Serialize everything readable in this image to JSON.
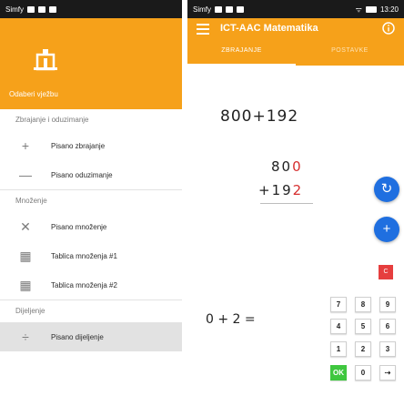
{
  "left_phone": {
    "status": {
      "carrier": "Simfy",
      "right": "ᯤ ⊡"
    },
    "drawer": {
      "header_title": "Odaberi vježbu",
      "sections": [
        {
          "title": "Zbrajanje i oduzimanje",
          "items": [
            {
              "icon": "plus-icon",
              "glyph": "+",
              "label": "Pisano zbrajanje"
            },
            {
              "icon": "minus-icon",
              "glyph": "—",
              "label": "Pisano oduzimanje"
            }
          ]
        },
        {
          "title": "Množenje",
          "items": [
            {
              "icon": "times-icon",
              "glyph": "✕",
              "label": "Pisano množenje"
            },
            {
              "icon": "table-icon",
              "glyph": "▦",
              "label": "Tablica množenja #1"
            },
            {
              "icon": "table-icon",
              "glyph": "▦",
              "label": "Tablica množenja #2"
            }
          ]
        },
        {
          "title": "Dijeljenje",
          "items": [
            {
              "icon": "divide-icon",
              "glyph": "÷",
              "label": "Pisano dijeljenje"
            }
          ]
        }
      ]
    }
  },
  "right_phone": {
    "status": {
      "carrier": "Simfy",
      "time": "13:20"
    },
    "appbar": {
      "title": "ICT-AAC Matematika"
    },
    "tabs": [
      {
        "label": "ZBRAJANJE",
        "active": true
      },
      {
        "label": "POSTAVKE",
        "active": false
      }
    ],
    "exercise": {
      "expression": "800+192",
      "addend_1_prefix": "80",
      "addend_1_highlight": "0",
      "addend_2_prefix": "+19",
      "addend_2_highlight": "2",
      "partial": "0 + 2 ="
    },
    "fab_refresh": "↻",
    "fab_add": "+",
    "clear_key": "C",
    "keypad": [
      "7",
      "8",
      "9",
      "4",
      "5",
      "6",
      "1",
      "2",
      "3",
      "OK",
      "0",
      "⇢"
    ]
  },
  "colors": {
    "accent": "#f6a11a",
    "fab": "#1f6fe0",
    "ok": "#3fc73f",
    "clear": "#e63e3e",
    "highlight": "#d62e2e"
  }
}
